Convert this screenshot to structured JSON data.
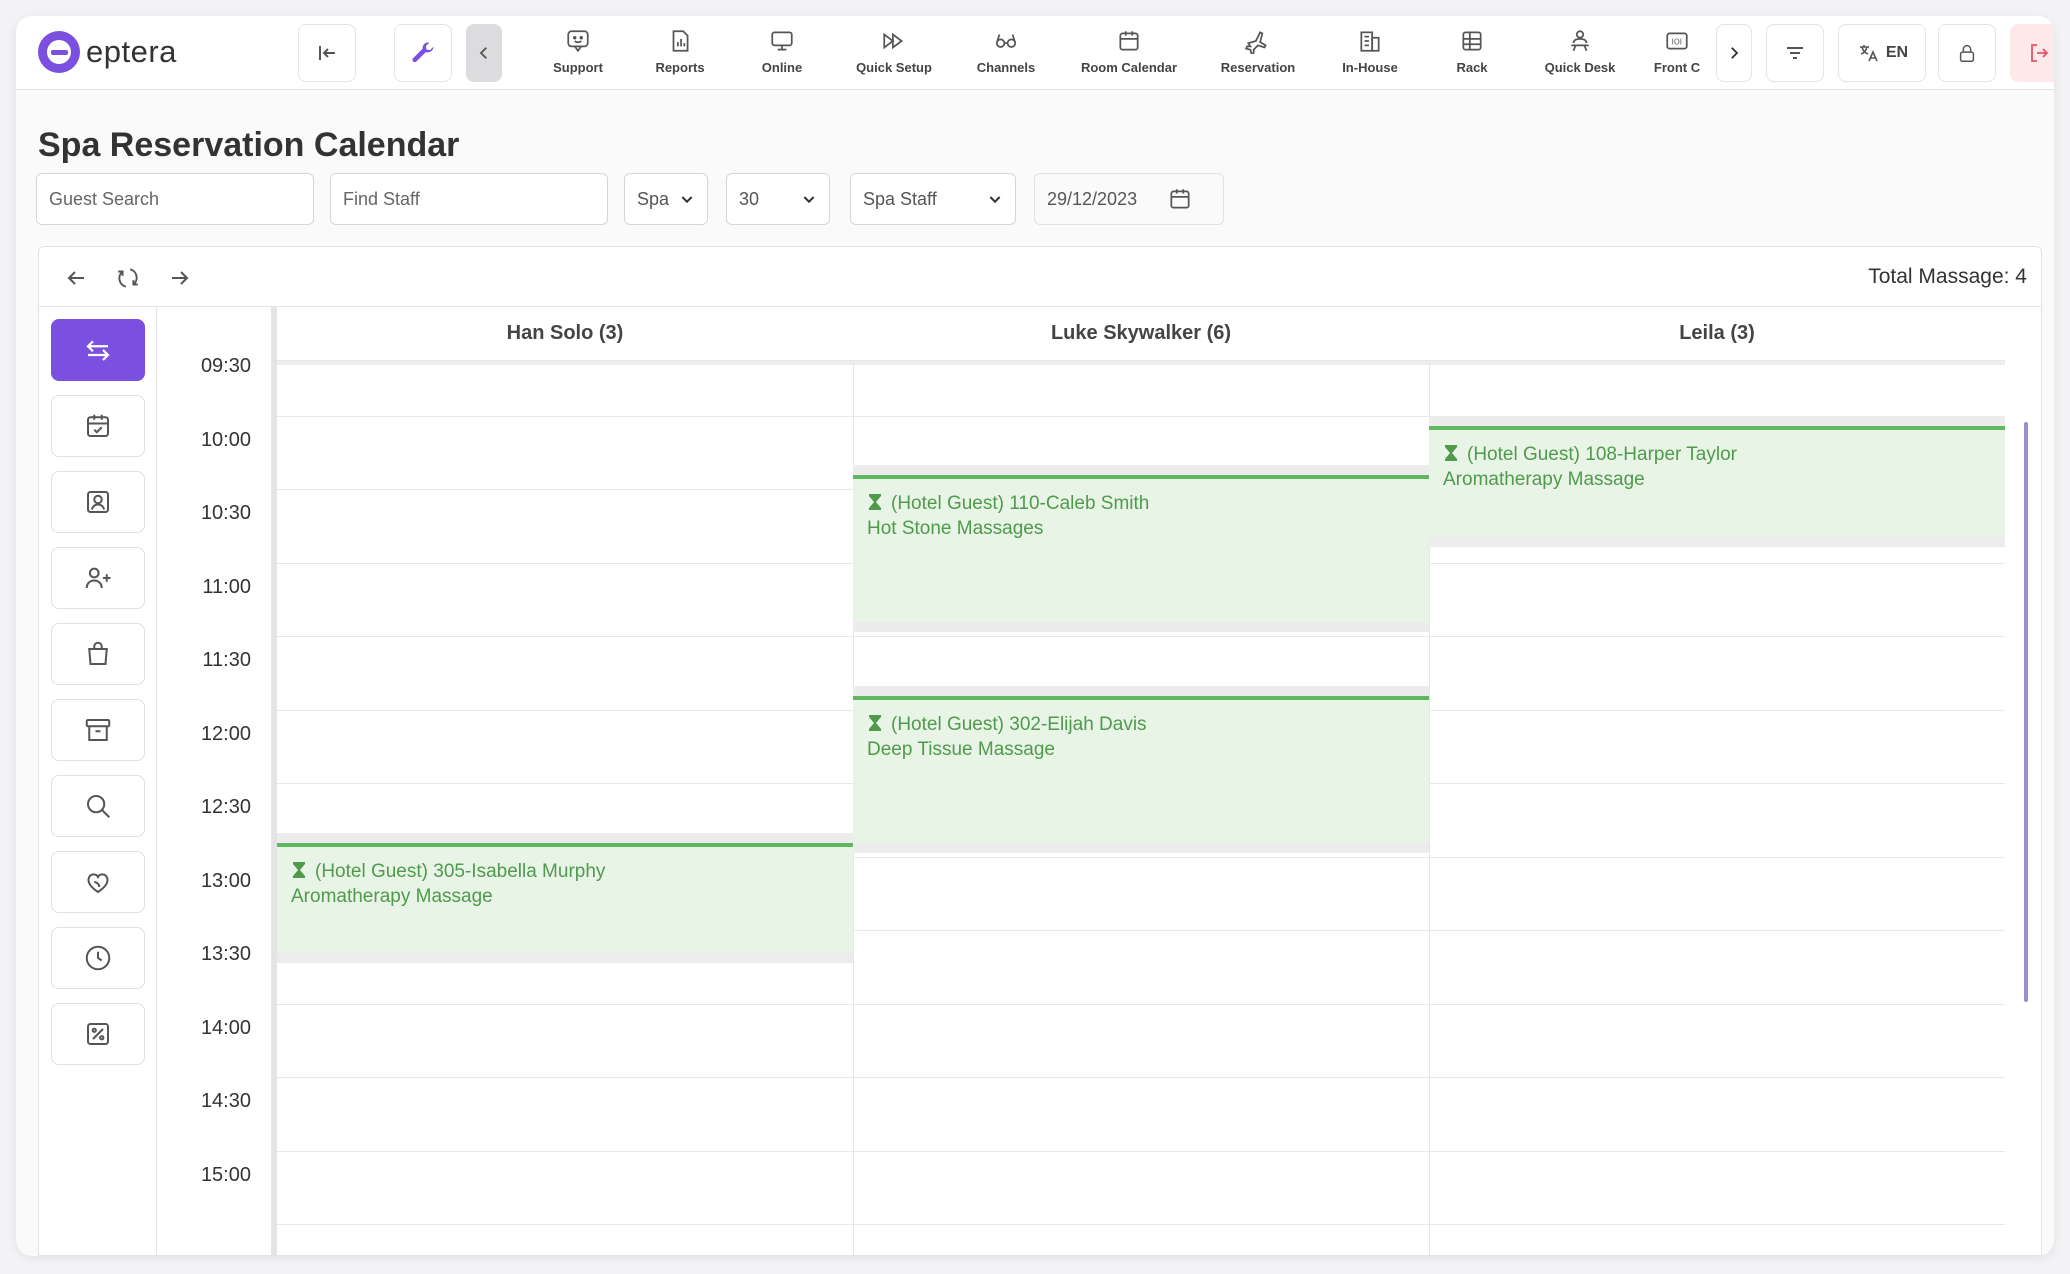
{
  "app": {
    "logo_text": "eptera",
    "brand_color": "#7b4fe0"
  },
  "topnav": {
    "items": [
      {
        "label": "Support",
        "icon": "support-chat-icon"
      },
      {
        "label": "Reports",
        "icon": "report-chart-icon"
      },
      {
        "label": "Online",
        "icon": "monitor-icon"
      },
      {
        "label": "Quick Setup",
        "icon": "fast-forward-icon"
      },
      {
        "label": "Channels",
        "icon": "glasses-icon"
      },
      {
        "label": "Room Calendar",
        "icon": "calendar-icon"
      },
      {
        "label": "Reservation",
        "icon": "plane-icon"
      },
      {
        "label": "In-House",
        "icon": "building-icon"
      },
      {
        "label": "Rack",
        "icon": "grid-table-icon"
      },
      {
        "label": "Quick Desk",
        "icon": "desk-person-icon"
      },
      {
        "label": "Front C",
        "icon": "id-card-icon"
      }
    ],
    "language": "EN"
  },
  "page": {
    "title": "Spa Reservation Calendar"
  },
  "filters": {
    "guest_search_placeholder": "Guest Search",
    "find_staff_placeholder": "Find Staff",
    "category": "Spa",
    "interval": "30",
    "staff_group": "Spa Staff",
    "date": "29/12/2023"
  },
  "toolbar": {
    "total_label": "Total Massage: 4"
  },
  "calendar": {
    "times": [
      "09:30",
      "10:00",
      "10:30",
      "11:00",
      "11:30",
      "12:00",
      "12:30",
      "13:00",
      "13:30",
      "14:00",
      "14:30",
      "15:00"
    ],
    "staff": [
      {
        "name": "Han Solo (3)"
      },
      {
        "name": "Luke Skywalker (6)"
      },
      {
        "name": "Leila (3)"
      }
    ],
    "events": [
      {
        "title": "(Hotel Guest) 305-Isabella Murphy",
        "service": "Aromatherapy Massage",
        "staff": "Han Solo (3)",
        "start": "12:45",
        "end": "13:30"
      },
      {
        "title": "(Hotel Guest) 110-Caleb Smith",
        "service": "Hot Stone Massages",
        "staff": "Luke Skywalker (6)",
        "start": "10:15",
        "end": "11:15"
      },
      {
        "title": "(Hotel Guest) 302-Elijah Davis",
        "service": "Deep Tissue Massage",
        "staff": "Luke Skywalker (6)",
        "start": "11:45",
        "end": "12:45"
      },
      {
        "title": "(Hotel Guest) 108-Harper Taylor",
        "service": "Aromatherapy Massage",
        "staff": "Leila (3)",
        "start": "09:55",
        "end": "10:40"
      }
    ],
    "event_color": "#5fb75f"
  }
}
